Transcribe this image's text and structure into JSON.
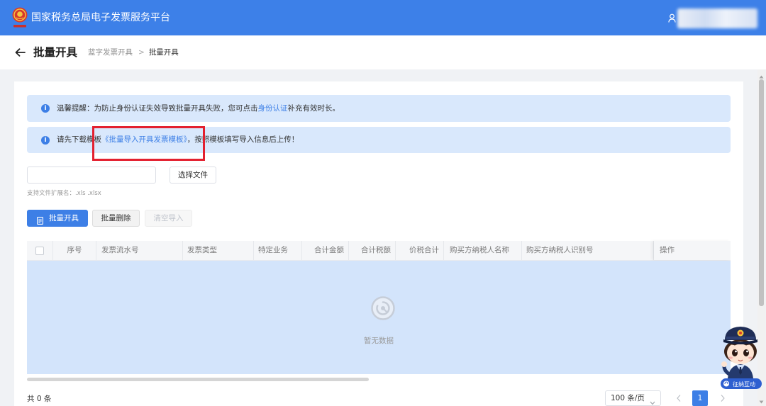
{
  "colors": {
    "header_bg": "#3d80e8",
    "primary": "#3d7fe6",
    "alert_bg": "#d9e8fc",
    "table_body_bg": "#d3e4fb",
    "highlight_border": "#e3202f",
    "link": "#3d7fe6"
  },
  "header": {
    "title": "国家税务总局电子发票服务平台",
    "logo_icon": "tax-emblem-logo",
    "user_icon": "user-icon"
  },
  "page": {
    "back_icon": "arrow-left-icon",
    "title": "批量开具",
    "breadcrumb": [
      "蓝字发票开具",
      "批量开具"
    ],
    "breadcrumb_separator": ">"
  },
  "alerts": {
    "auth_reminder": {
      "icon": "info-icon",
      "prefix": "温馨提醒：为防止身份认证失效导致批量开具失败，您可点击",
      "link": "身份认证",
      "suffix": "补充有效时长。"
    },
    "template_download": {
      "icon": "info-icon",
      "prefix": "请先下载模板",
      "link": "《批量导入开具发票模板》",
      "suffix": "，按照模板填写导入信息后上传！"
    }
  },
  "upload": {
    "file_name": "",
    "choose_button": "选择文件",
    "hint": "支持文件扩展名：.xls .xlsx"
  },
  "actions": {
    "batch_issue": "批量开具",
    "batch_issue_icon": "document-icon",
    "batch_delete": "批量删除",
    "clear_import": "清空导入"
  },
  "table": {
    "columns": [
      "序号",
      "发票流水号",
      "发票类型",
      "特定业务",
      "合计金额",
      "合计税额",
      "价税合计",
      "购买方纳税人名称",
      "购买方纳税人识别号",
      "操作"
    ],
    "rows": [],
    "empty_text": "暂无数据",
    "empty_icon": "empty-data-icon"
  },
  "footer": {
    "total": "共 0 条",
    "page_size": "100 条/页",
    "current_page": "1",
    "prev_icon": "chevron-left-icon",
    "next_icon": "chevron-right-icon"
  },
  "assistant": {
    "icon": "tax-officer-mascot",
    "label": "征纳互动"
  }
}
